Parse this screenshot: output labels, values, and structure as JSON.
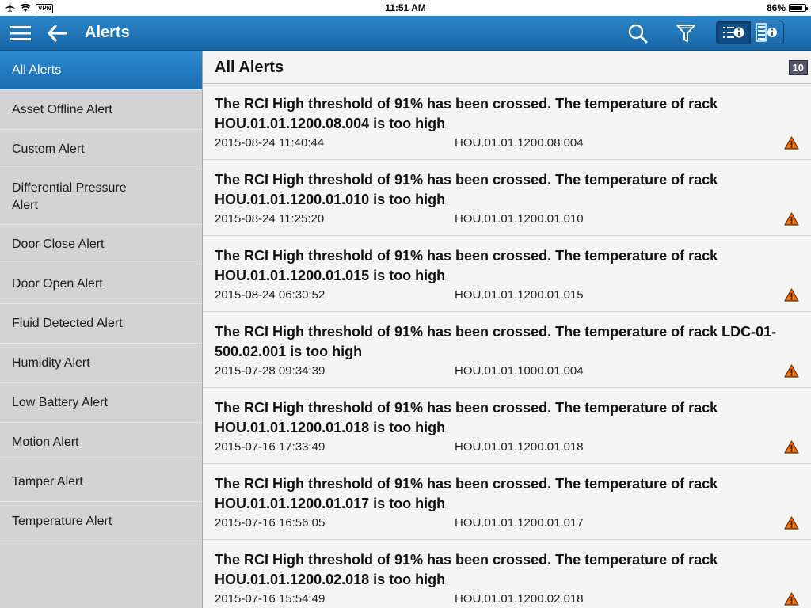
{
  "status_bar": {
    "vpn_label": "VPN",
    "time": "11:51 AM",
    "battery": "86%",
    "battery_level": 0.86
  },
  "nav": {
    "title": "Alerts",
    "icons": [
      "menu-icon",
      "back-arrow-icon",
      "search-icon",
      "filter-icon",
      "list-info-icon",
      "detail-info-icon"
    ]
  },
  "sidebar": {
    "items": [
      {
        "label": "All Alerts",
        "selected": true
      },
      {
        "label": "Asset Offline Alert"
      },
      {
        "label": "Custom Alert"
      },
      {
        "label": "Differential Pressure Alert"
      },
      {
        "label": "Door Close Alert"
      },
      {
        "label": "Door Open Alert"
      },
      {
        "label": "Fluid Detected Alert"
      },
      {
        "label": "Humidity Alert"
      },
      {
        "label": "Low Battery Alert"
      },
      {
        "label": "Motion Alert"
      },
      {
        "label": "Tamper Alert"
      },
      {
        "label": "Temperature Alert"
      }
    ]
  },
  "main": {
    "title": "All Alerts",
    "count": "10",
    "alerts": [
      {
        "message": "The RCI High threshold of 91% has been crossed. The temperature of rack HOU.01.01.1200.08.004 is too high",
        "timestamp": "2015-08-24 11:40:44",
        "rack": "HOU.01.01.1200.08.004"
      },
      {
        "message": "The RCI High threshold of 91% has been crossed. The temperature of rack HOU.01.01.1200.01.010 is too high",
        "timestamp": "2015-08-24 11:25:20",
        "rack": "HOU.01.01.1200.01.010"
      },
      {
        "message": "The RCI High threshold of 91% has been crossed. The temperature of rack HOU.01.01.1200.01.015 is too high",
        "timestamp": "2015-08-24 06:30:52",
        "rack": "HOU.01.01.1200.01.015"
      },
      {
        "message": "The RCI High threshold of 91% has been crossed. The temperature of rack LDC-01-500.02.001 is too high",
        "timestamp": "2015-07-28 09:34:39",
        "rack": "HOU.01.01.1000.01.004"
      },
      {
        "message": "The RCI High threshold of 91% has been crossed. The temperature of rack HOU.01.01.1200.01.018 is too high",
        "timestamp": "2015-07-16 17:33:49",
        "rack": "HOU.01.01.1200.01.018"
      },
      {
        "message": "The RCI High threshold of 91% has been crossed. The temperature of rack HOU.01.01.1200.01.017 is too high",
        "timestamp": "2015-07-16 16:56:05",
        "rack": "HOU.01.01.1200.01.017"
      },
      {
        "message": "The RCI High threshold of 91% has been crossed. The temperature of rack HOU.01.01.1200.02.018 is too high",
        "timestamp": "2015-07-16 15:54:49",
        "rack": "HOU.01.01.1200.02.018"
      }
    ]
  },
  "colors": {
    "nav_blue": "#1f77bb",
    "selected_blue": "#2284c8",
    "warning_orange": "#e8720c"
  }
}
